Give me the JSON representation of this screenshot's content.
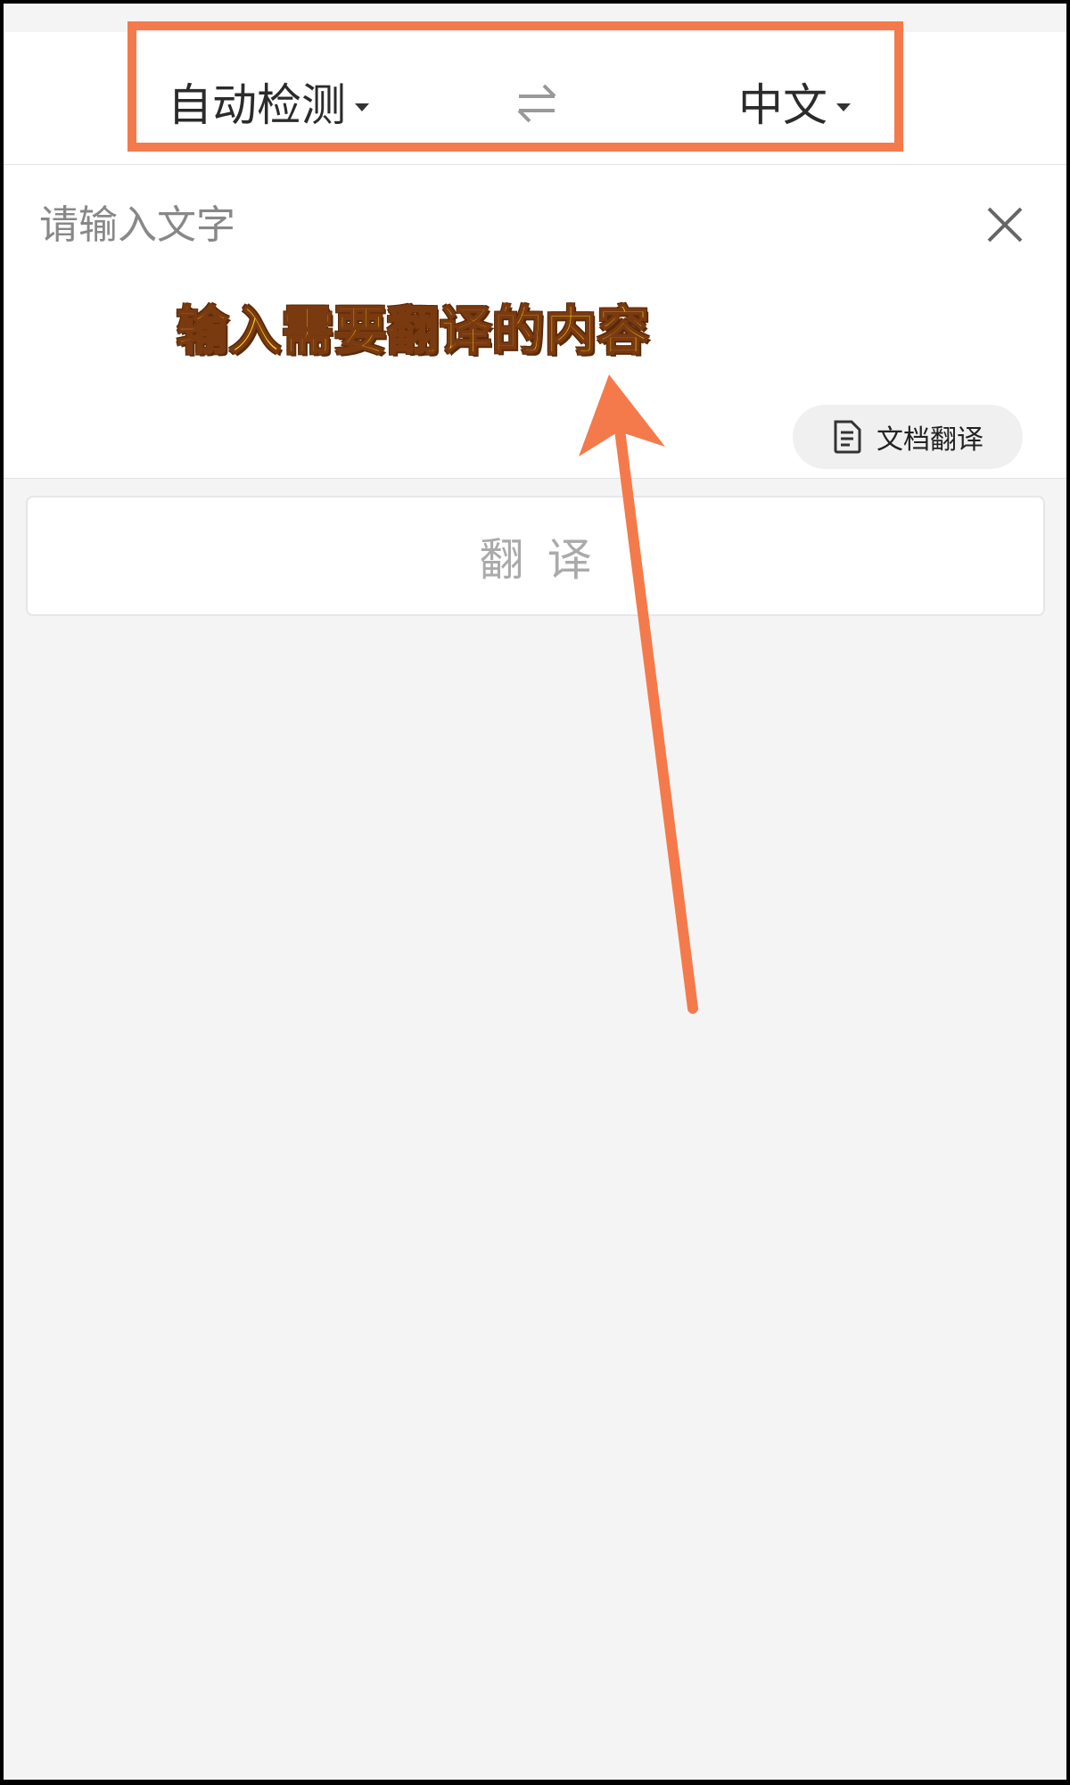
{
  "language_bar": {
    "source_language": "自动检测",
    "target_language": "中文",
    "swap_icon": "swap-arrows-icon"
  },
  "input": {
    "placeholder": "请输入文字",
    "value": "",
    "clear_icon": "close-icon"
  },
  "document_button": {
    "label": "文档翻译",
    "icon": "document-icon"
  },
  "translate_button": {
    "label": "翻译"
  },
  "annotation": {
    "caption": "输入需要翻译的内容",
    "highlight_color": "#f47a4b",
    "caption_color": "#ffd31a"
  }
}
